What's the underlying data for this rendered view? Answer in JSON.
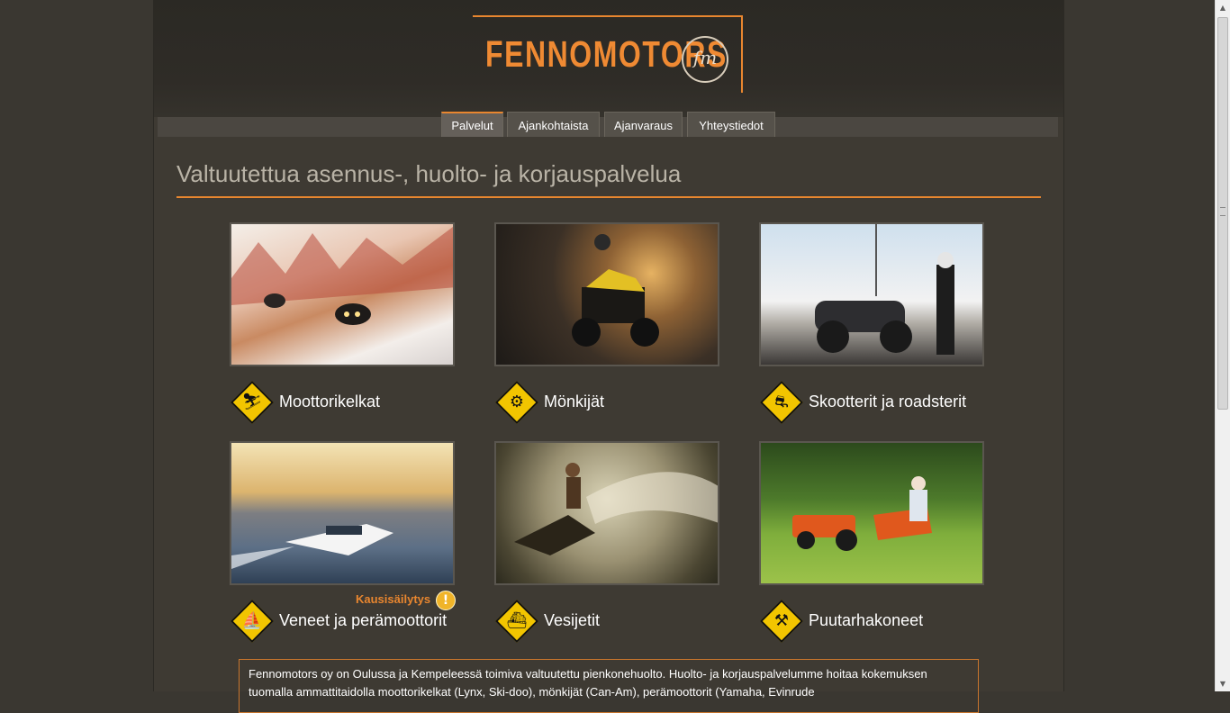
{
  "brand": {
    "name": "FENNOMOTORS",
    "emblem": "fm",
    "accent": "#e8862f"
  },
  "nav": {
    "tabs": [
      {
        "label": "Palvelut",
        "active": true
      },
      {
        "label": "Ajankohtaista",
        "active": false
      },
      {
        "label": "Ajanvaraus",
        "active": false
      },
      {
        "label": "Yhteystiedot",
        "active": false
      }
    ]
  },
  "main": {
    "title": "Valtuutettua asennus-, huolto- ja korjauspalvelua",
    "services": [
      {
        "label": "Moottorikelkat",
        "icon": "snowmobile-icon"
      },
      {
        "label": "Mönkijät",
        "icon": "atv-icon"
      },
      {
        "label": "Skootterit ja roadsterit",
        "icon": "motorcycle-icon"
      },
      {
        "label": "Veneet ja perämoottorit",
        "icon": "boat-icon"
      },
      {
        "label": "Vesijetit",
        "icon": "jetski-icon"
      },
      {
        "label": "Puutarhakoneet",
        "icon": "lawnmower-icon"
      }
    ],
    "season_link": {
      "label": "Kausisäilytys",
      "badge": "!"
    },
    "info_text": "Fennomotors oy on Oulussa ja Kempeleessä toimiva valtuutettu pienkonehuolto. Huolto- ja korjauspalvelumme hoitaa kokemuksen tuomalla ammattitaidolla moottorikelkat (Lynx, Ski-doo), mönkijät (Can-Am), perämoottorit (Yamaha, Evinrude"
  }
}
